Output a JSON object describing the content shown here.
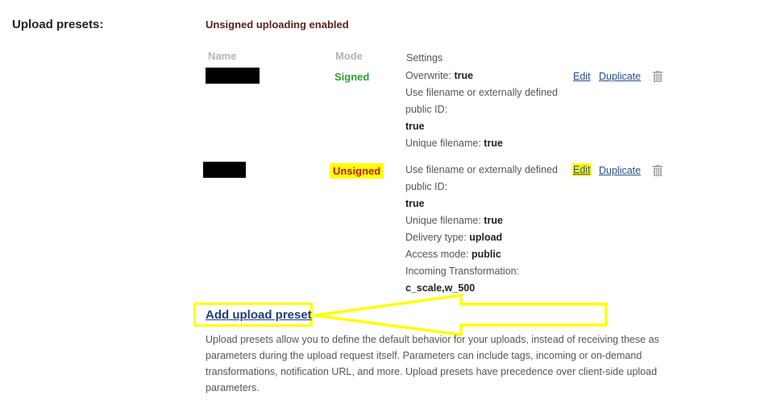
{
  "section_label": "Upload presets:",
  "unsigned_status": "Unsigned uploading enabled",
  "columns": {
    "name": "Name",
    "mode": "Mode",
    "settings": "Settings"
  },
  "presets": [
    {
      "mode": "Signed",
      "settings": [
        {
          "key": "Overwrite:",
          "value": "true"
        },
        {
          "key": "Use filename or externally defined",
          "value": ""
        },
        {
          "key": "public ID:",
          "value": ""
        },
        {
          "key": "",
          "value": "true"
        },
        {
          "key": "Unique filename:",
          "value": "true"
        }
      ],
      "actions": {
        "edit": "Edit",
        "duplicate": "Duplicate"
      }
    },
    {
      "mode": "Unsigned",
      "settings": [
        {
          "key": "Use filename or externally defined",
          "value": ""
        },
        {
          "key": "public ID:",
          "value": ""
        },
        {
          "key": "",
          "value": "true"
        },
        {
          "key": "Unique filename:",
          "value": "true"
        },
        {
          "key": "Delivery type:",
          "value": "upload"
        },
        {
          "key": "Access mode:",
          "value": "public"
        },
        {
          "key": "Incoming Transformation:",
          "value": ""
        },
        {
          "key": "",
          "value": "c_scale,w_500"
        }
      ],
      "actions": {
        "edit": "Edit",
        "duplicate": "Duplicate"
      }
    }
  ],
  "add_preset_label": "Add upload preset",
  "description": "Upload presets allow you to define the default behavior for your uploads, instead of receiving these as parameters during the upload request itself. Parameters can include tags, incoming or on-demand transformations, notification URL, and more. Upload presets have precedence over client-side upload parameters.",
  "icons": {
    "delete": "trash-icon",
    "annotation": "arrow-icon"
  },
  "colors": {
    "highlight": "#ffff00",
    "signed": "#2e9e2e",
    "unsigned": "#c01818",
    "link": "#2a4c8a"
  }
}
